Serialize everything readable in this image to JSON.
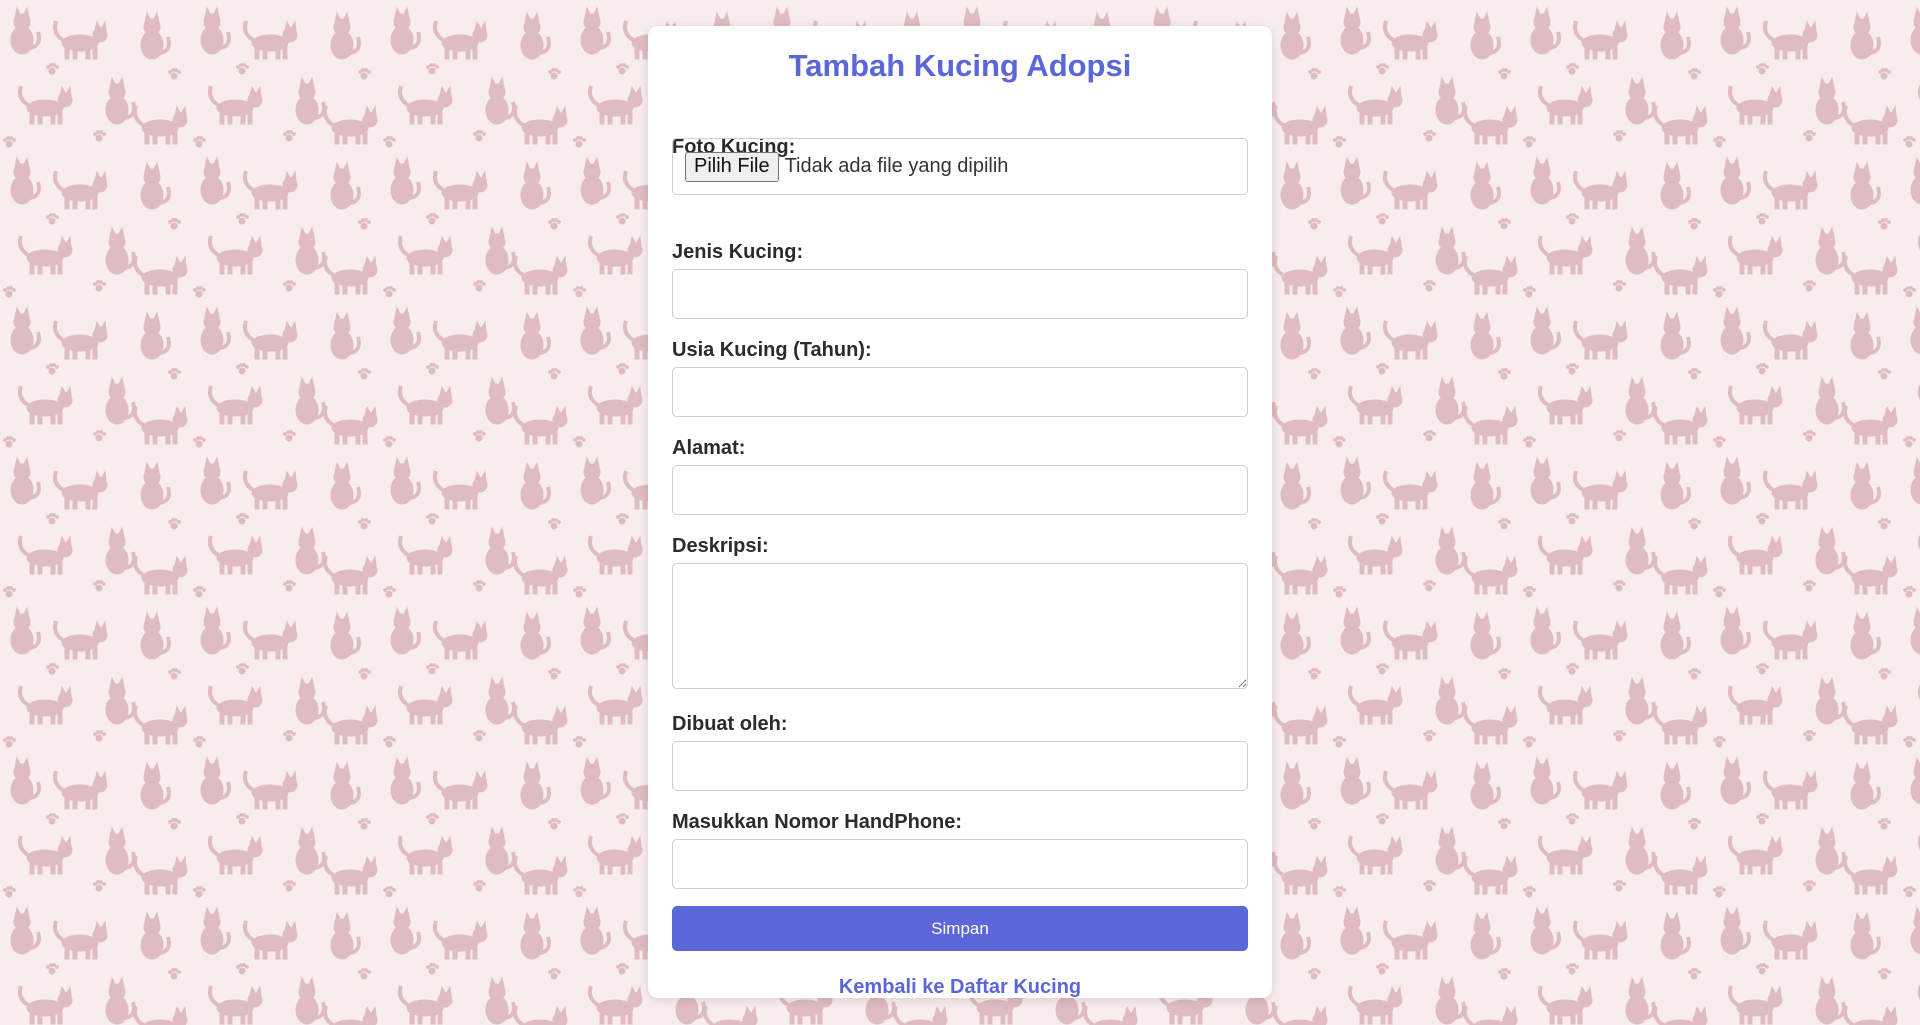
{
  "page": {
    "title": "Tambah Kucing Adopsi",
    "background_color": "#f8ecec",
    "pattern_color": "#dfbcc2",
    "accent_color": "#5b67d8"
  },
  "form": {
    "photo": {
      "label": "Foto Kucing:",
      "button_label": "Pilih File",
      "status_text": "Tidak ada file yang dipilih"
    },
    "breed": {
      "label": "Jenis Kucing:",
      "value": ""
    },
    "age": {
      "label": "Usia Kucing (Tahun):",
      "value": ""
    },
    "address": {
      "label": "Alamat:",
      "value": ""
    },
    "description": {
      "label": "Deskripsi:",
      "value": ""
    },
    "created_by": {
      "label": "Dibuat oleh:",
      "value": ""
    },
    "phone": {
      "label": "Masukkan Nomor HandPhone:",
      "value": ""
    },
    "submit_label": "Simpan"
  },
  "back_link": {
    "label": "Kembali ke Daftar Kucing"
  },
  "icons": {
    "background": "cat-silhouette-pattern",
    "paw": "paw-print-icon"
  }
}
